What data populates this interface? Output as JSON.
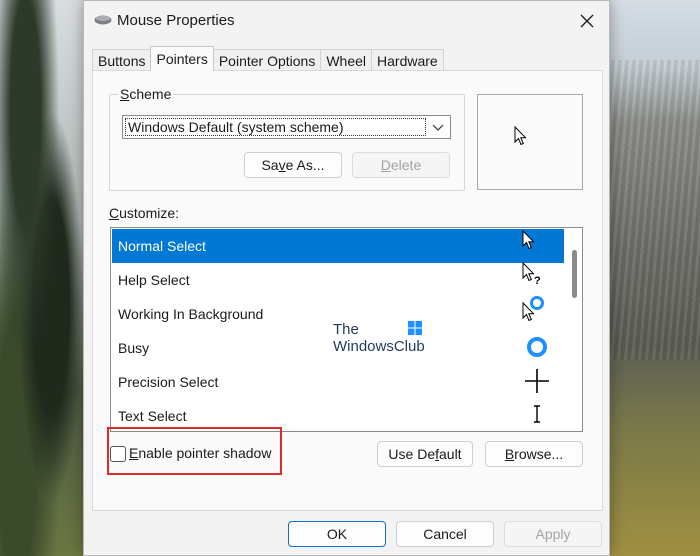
{
  "window": {
    "title": "Mouse Properties",
    "close_label": "Close"
  },
  "tabs": [
    {
      "label": "Buttons",
      "active": false
    },
    {
      "label": "Pointers",
      "active": true
    },
    {
      "label": "Pointer Options",
      "active": false
    },
    {
      "label": "Wheel",
      "active": false
    },
    {
      "label": "Hardware",
      "active": false
    }
  ],
  "scheme": {
    "group_label_prefix": "S",
    "group_label_rest": "cheme",
    "selected": "Windows Default (system scheme)",
    "save_as_prefix": "Sa",
    "save_as_key": "v",
    "save_as_rest": "e As...",
    "delete_key": "D",
    "delete_rest": "elete"
  },
  "customize": {
    "label_key": "C",
    "label_rest": "ustomize:",
    "items": [
      {
        "label": "Normal Select",
        "icon": "arrow-cursor-icon",
        "selected": true
      },
      {
        "label": "Help Select",
        "icon": "help-cursor-icon",
        "selected": false
      },
      {
        "label": "Working In Background",
        "icon": "working-cursor-icon",
        "selected": false
      },
      {
        "label": "Busy",
        "icon": "busy-cursor-icon",
        "selected": false
      },
      {
        "label": "Precision Select",
        "icon": "crosshair-cursor-icon",
        "selected": false
      },
      {
        "label": "Text Select",
        "icon": "ibeam-cursor-icon",
        "selected": false
      }
    ]
  },
  "watermark": {
    "line1": "The",
    "line2": "WindowsClub"
  },
  "shadow": {
    "label_key": "E",
    "label_rest": "nable pointer shadow",
    "checked": false
  },
  "buttons": {
    "use_default_prefix": "Use De",
    "use_default_key": "f",
    "use_default_rest": "ault",
    "browse_key": "B",
    "browse_rest": "rowse...",
    "ok": "OK",
    "cancel": "Cancel",
    "apply": "Apply"
  },
  "colors": {
    "accent": "#0078d4",
    "highlight": "#e0292b"
  }
}
